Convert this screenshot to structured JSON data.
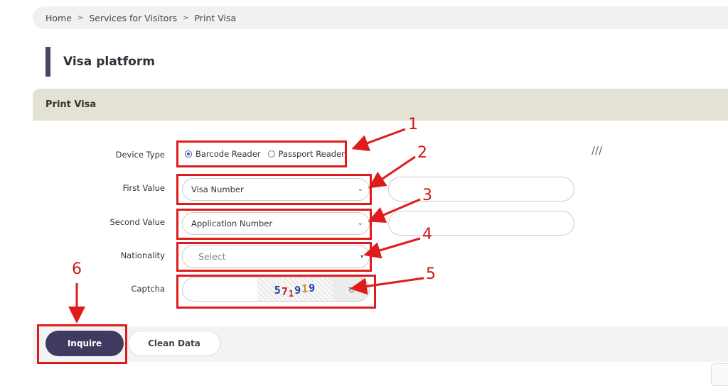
{
  "breadcrumb": {
    "items": [
      "Home",
      "Services for Visitors",
      "Print Visa"
    ],
    "separator": ">"
  },
  "page": {
    "title": "Visa platform"
  },
  "panel": {
    "header": "Print Visa"
  },
  "form": {
    "device_type": {
      "label": "Device Type",
      "options": [
        "Barcode Reader",
        "Passport Reader"
      ],
      "selected": "Barcode Reader"
    },
    "first_value": {
      "label": "First Value",
      "select_value": "Visa Number",
      "input_value": ""
    },
    "second_value": {
      "label": "Second Value",
      "select_value": "Application Number",
      "input_value": ""
    },
    "nationality": {
      "label": "Nationality",
      "placeholder": "Select"
    },
    "captcha": {
      "label": "Captcha",
      "input_value": "",
      "image_text": [
        "5",
        "7",
        "1",
        "9",
        "1",
        "9"
      ]
    }
  },
  "buttons": {
    "inquire": "Inquire",
    "clean": "Clean Data"
  },
  "annotations": [
    "1",
    "2",
    "3",
    "4",
    "5",
    "6"
  ],
  "colors": {
    "accent": "#3f3b60",
    "annotation": "#e01b1b",
    "panel_header": "#e4e2d5"
  },
  "icons": {
    "chevron": "chevron-down-icon",
    "refresh": "refresh-icon",
    "resize": "resize-handle-icon"
  }
}
